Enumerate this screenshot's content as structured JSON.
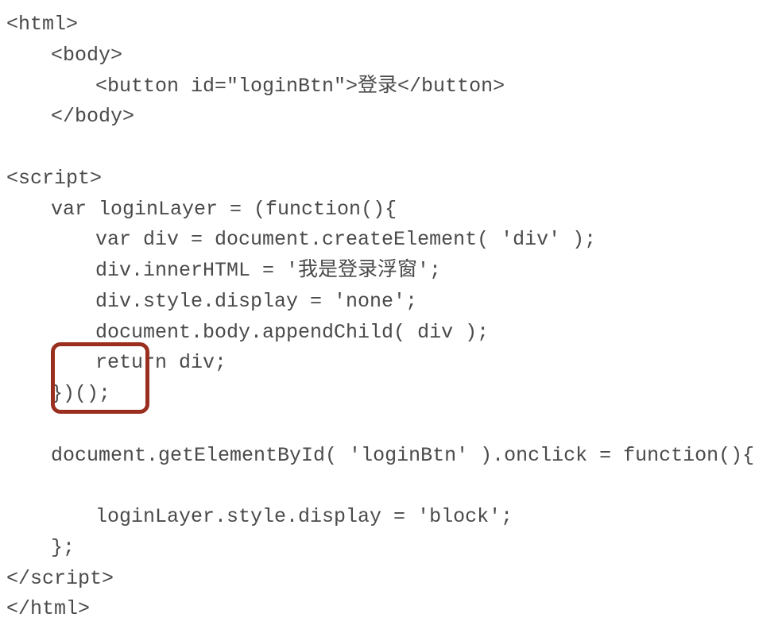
{
  "code": {
    "line1": "<html>",
    "line2": "<body>",
    "line3": "<button id=\"loginBtn\">登录</button>",
    "line4": "</body>",
    "line5": "",
    "line6": "<script>",
    "line7": "var loginLayer = (function(){",
    "line8": "var div = document.createElement( 'div' );",
    "line9": "div.innerHTML = '我是登录浮窗';",
    "line10": "div.style.display = 'none';",
    "line11": "document.body.appendChild( div );",
    "line12": "return div;",
    "line13": "})();",
    "line14": "",
    "line15": "document.getElementById( 'loginBtn' ).onclick = function(){",
    "line16": "",
    "line17": "loginLayer.style.display = 'block';",
    "line18": "};",
    "line19": "</script>",
    "line20": "</html>"
  },
  "annotations": {
    "highlight_target": "IIFE closing invocation })();"
  }
}
